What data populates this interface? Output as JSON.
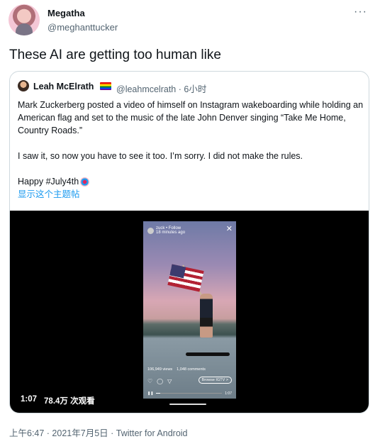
{
  "tweet": {
    "author_name": "Megatha",
    "author_handle": "@meghanttucker",
    "more_icon": "more-horizontal-icon",
    "text": "These AI are getting too human like",
    "footer": "上午6:47 · 2021年7月5日 · Twitter for Android"
  },
  "quote": {
    "author_name": "Leah McElrath",
    "author_handle": "@leahmcelrath · 6小时",
    "badge_icon": "rainbow-flag-icon",
    "paragraph1": "Mark Zuckerberg posted a video of himself on Instagram wakeboarding while holding an American flag and set to the music of the late John Denver singing “Take Me Home, Country Roads.”",
    "paragraph2": "I saw it, so now you have to see it too. I’m sorry. I did not make the rules.",
    "hashtag_line": "Happy #July4th",
    "show_thread": "显示这个主题帖"
  },
  "video": {
    "duration": "1:07",
    "views": "78.4万 次观看",
    "story": {
      "header": "zuck • Follow",
      "subheader": "18 minutes ago",
      "views": "106,949 views",
      "comments": "1,048 comments",
      "browse_label": "Browse IGTV >",
      "time": "1:07",
      "progress": 0.06
    }
  }
}
